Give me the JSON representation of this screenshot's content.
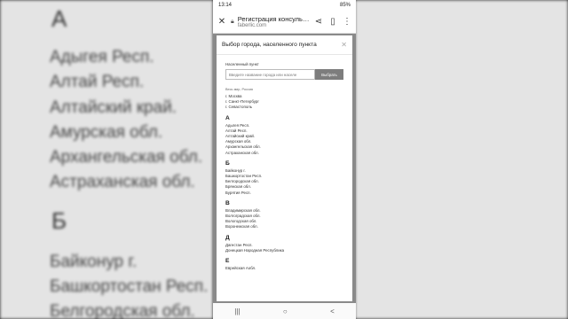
{
  "background": {
    "left_letters": [
      "А",
      "Б"
    ],
    "left_lines": [
      "Адыгея Респ.",
      "Алтай Респ.",
      "Алтайский край.",
      "Амурская обл.",
      "Архангельская обл.",
      "Астраханская обл.",
      "Байконур г.",
      "Башкортостан Респ.",
      "Белгородская обл."
    ]
  },
  "statusbar": {
    "time": "13:14",
    "right": "85%"
  },
  "browser": {
    "page_title": "Регистрация консуль…",
    "domain": "faberlic.com"
  },
  "modal": {
    "title": "Выбор города, населенного пункта",
    "field_label": "Населенный пункт",
    "search_placeholder": "Введите название города или населе",
    "search_button": "Выбрать",
    "caption": "Весь мир, Россия",
    "top_cities": [
      "г. Москва",
      "г. Санкт-Петербург",
      "г. Севастополь"
    ],
    "groups": [
      {
        "letter": "А",
        "items": [
          "Адыгея Респ.",
          "Алтай Респ.",
          "Алтайский край.",
          "Амурская обл.",
          "Архангельская обл.",
          "Астраханская обл."
        ]
      },
      {
        "letter": "Б",
        "items": [
          "Байконур г.",
          "Башкортостан Респ.",
          "Белгородская обл.",
          "Брянская обл.",
          "Бурятия Респ."
        ]
      },
      {
        "letter": "В",
        "items": [
          "Владимирская обл.",
          "Волгоградская обл.",
          "Вологодская обл.",
          "Воронежская обл."
        ]
      },
      {
        "letter": "Д",
        "items": [
          "Дагестан Респ.",
          "Донецкая Народная Республика"
        ]
      },
      {
        "letter": "Е",
        "items": [
          "Еврейская Аобл."
        ]
      }
    ]
  },
  "navbar": {
    "recent": "|||",
    "home": "○",
    "back": "<"
  }
}
